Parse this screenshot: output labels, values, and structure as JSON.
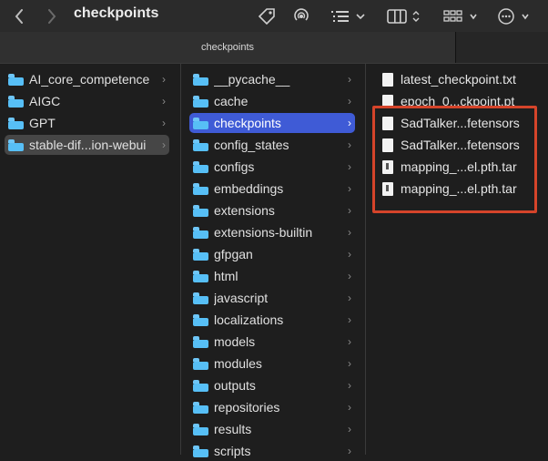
{
  "toolbar": {
    "title": "checkpoints",
    "back_icon": "chevron-left-icon",
    "forward_icon": "chevron-right-icon",
    "icons": [
      "tag-icon",
      "airdrop-icon",
      "list-view-icon",
      "column-view-icon",
      "gallery-icon",
      "more-icon"
    ]
  },
  "tab": {
    "label": "checkpoints"
  },
  "col1": {
    "items": [
      {
        "label": "AI_core_competence"
      },
      {
        "label": "AIGC"
      },
      {
        "label": "GPT"
      },
      {
        "label": "stable-dif...ion-webui"
      }
    ]
  },
  "col2": {
    "items": [
      {
        "label": "__pycache__"
      },
      {
        "label": "cache"
      },
      {
        "label": "checkpoints"
      },
      {
        "label": "config_states"
      },
      {
        "label": "configs"
      },
      {
        "label": "embeddings"
      },
      {
        "label": "extensions"
      },
      {
        "label": "extensions-builtin"
      },
      {
        "label": "gfpgan"
      },
      {
        "label": "html"
      },
      {
        "label": "javascript"
      },
      {
        "label": "localizations"
      },
      {
        "label": "models"
      },
      {
        "label": "modules"
      },
      {
        "label": "outputs"
      },
      {
        "label": "repositories"
      },
      {
        "label": "results"
      },
      {
        "label": "scripts"
      }
    ]
  },
  "col3": {
    "items": [
      {
        "label": "latest_checkpoint.txt"
      },
      {
        "label": "epoch_0...ckpoint.pt"
      },
      {
        "label": "SadTalker...fetensors"
      },
      {
        "label": "SadTalker...fetensors"
      },
      {
        "label": "mapping_...el.pth.tar"
      },
      {
        "label": "mapping_...el.pth.tar"
      }
    ]
  },
  "colors": {
    "accent": "#3f5bd6",
    "highlight": "#d5442a",
    "folder": "#2aa3ee"
  }
}
